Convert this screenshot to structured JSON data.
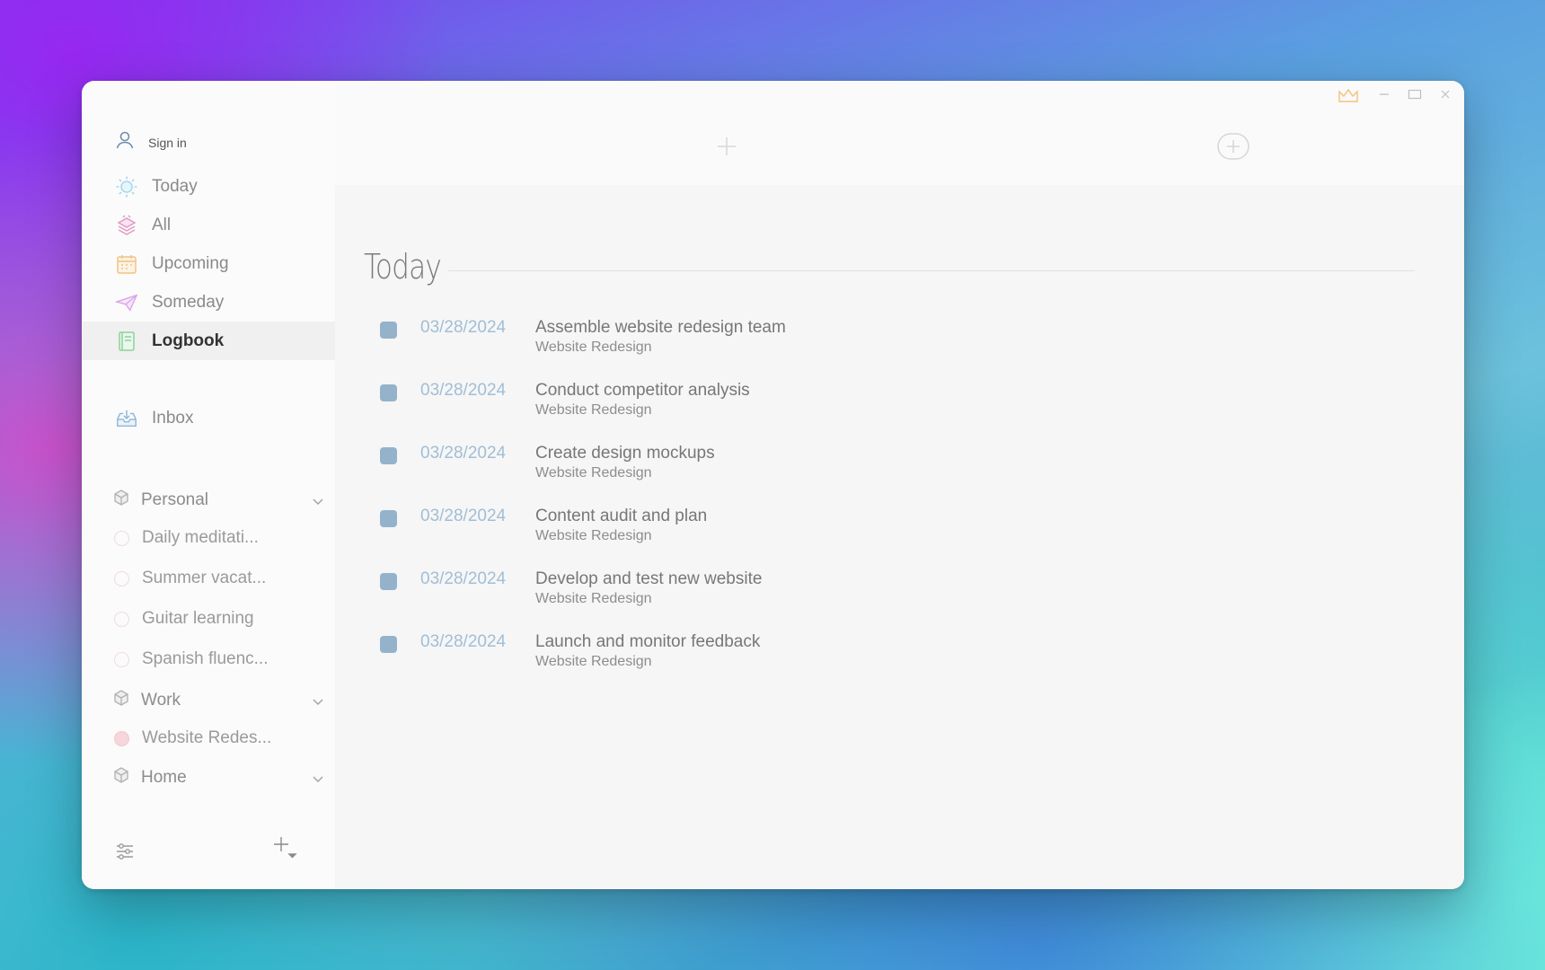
{
  "colors": {
    "accent": "#94b3cb",
    "date": "#a1bed5",
    "crown": "#f3c27a"
  },
  "sidebar": {
    "signin_label": "Sign in",
    "nav": [
      {
        "label": "Today",
        "icon": "sun-icon"
      },
      {
        "label": "All",
        "icon": "stack-icon"
      },
      {
        "label": "Upcoming",
        "icon": "calendar-icon"
      },
      {
        "label": "Someday",
        "icon": "paper-plane-icon"
      },
      {
        "label": "Logbook",
        "icon": "book-icon",
        "active": true
      }
    ],
    "inbox_label": "Inbox",
    "groups": [
      {
        "label": "Personal",
        "projects": [
          "Daily meditati...",
          "Summer vacat...",
          "Guitar learning",
          "Spanish fluenc..."
        ]
      },
      {
        "label": "Work",
        "projects": [
          "Website Redes..."
        ]
      },
      {
        "label": "Home",
        "projects": []
      }
    ]
  },
  "main": {
    "heading": "Today",
    "tasks": [
      {
        "date": "03/28/2024",
        "title": "Assemble website redesign team",
        "project": "Website Redesign"
      },
      {
        "date": "03/28/2024",
        "title": "Conduct competitor analysis",
        "project": "Website Redesign"
      },
      {
        "date": "03/28/2024",
        "title": "Create design mockups",
        "project": "Website Redesign"
      },
      {
        "date": "03/28/2024",
        "title": "Content audit and plan",
        "project": "Website Redesign"
      },
      {
        "date": "03/28/2024",
        "title": "Develop and test new website",
        "project": "Website Redesign"
      },
      {
        "date": "03/28/2024",
        "title": "Launch and monitor feedback",
        "project": "Website Redesign"
      }
    ]
  }
}
